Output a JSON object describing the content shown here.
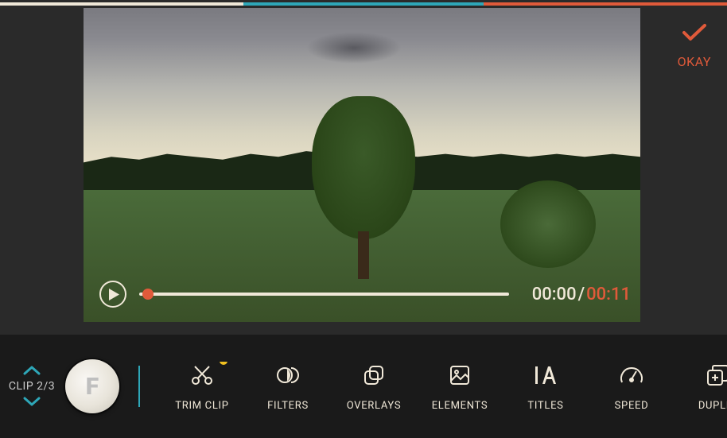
{
  "progress": {
    "segments": [
      "white",
      "teal",
      "orange"
    ]
  },
  "player": {
    "current_time": "00:00",
    "total_time": "00:11",
    "separator": "/"
  },
  "okay": {
    "label": "OKAY"
  },
  "clip_nav": {
    "label": "CLIP 2/3"
  },
  "clip_thumb_initial": "F",
  "tools": [
    {
      "label": "TRIM CLIP",
      "has_dot": true
    },
    {
      "label": "FILTERS"
    },
    {
      "label": "OVERLAYS"
    },
    {
      "label": "ELEMENTS"
    },
    {
      "label": "TITLES"
    },
    {
      "label": "SPEED"
    },
    {
      "label": "DUPLIC"
    }
  ]
}
